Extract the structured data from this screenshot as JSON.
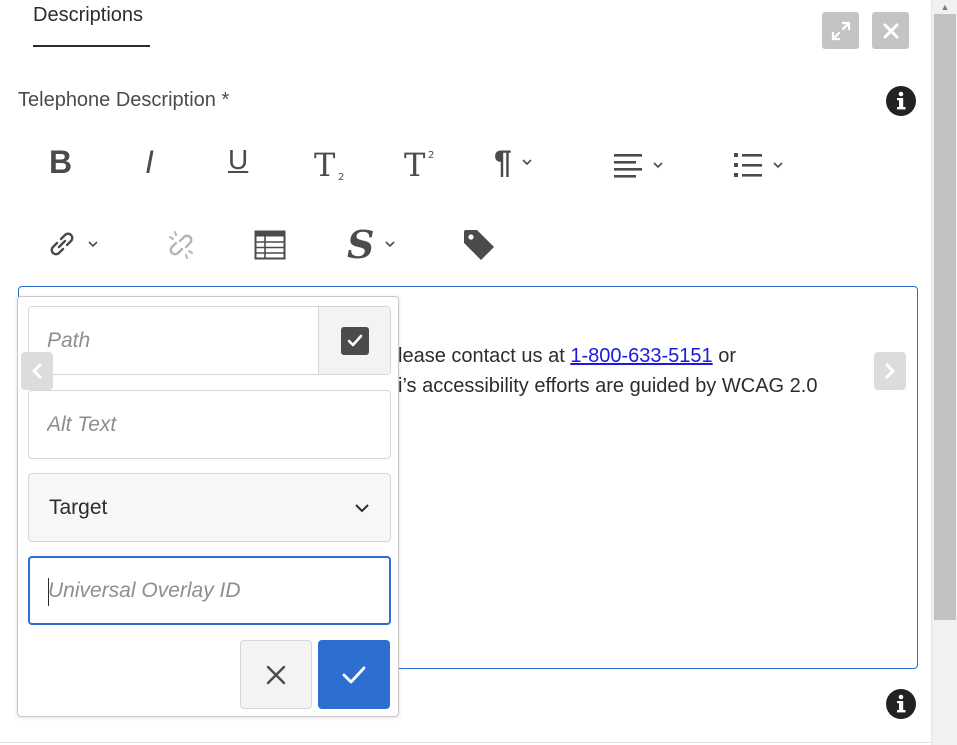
{
  "tab": {
    "label": "Descriptions"
  },
  "field": {
    "label": "Telephone Description *"
  },
  "editor": {
    "line1_prefix": "lease contact us at ",
    "phone_link": "1-800-633-5151",
    "line1_suffix": " or",
    "line2": "i’s accessibility efforts are guided by WCAG 2.0"
  },
  "link_dialog": {
    "path_placeholder": "Path",
    "alt_text_placeholder": "Alt Text",
    "target_label": "Target",
    "overlay_id_placeholder": "Universal Overlay ID"
  },
  "toolbar": {
    "bold": "B",
    "italic": "I",
    "underline": "U",
    "paragraph": "¶"
  },
  "colors": {
    "accent": "#2d6fd1",
    "icon": "#4b4b4b",
    "link": "#1a1ae0"
  },
  "icons": [
    "fullscreen-icon",
    "close-icon",
    "info-icon",
    "link-icon",
    "unlink-icon",
    "table-icon",
    "special-chars-icon",
    "tag-icon",
    "chevron-left-icon",
    "chevron-right-icon",
    "checkmark-icon"
  ]
}
